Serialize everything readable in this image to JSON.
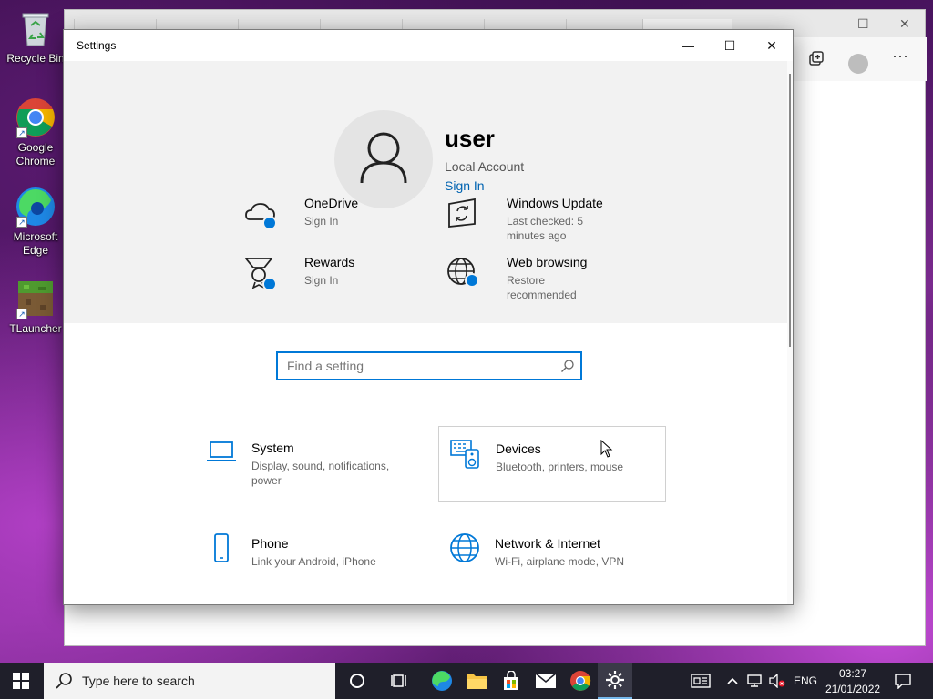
{
  "desktop": {
    "icons": [
      {
        "label": "Recycle Bin",
        "icon": "recycle-bin-icon"
      },
      {
        "label": "Google Chrome",
        "icon": "chrome-icon"
      },
      {
        "label": "Microsoft Edge",
        "icon": "edge-icon"
      },
      {
        "label": "TLauncher",
        "icon": "tlauncher-icon"
      }
    ]
  },
  "settings": {
    "window_title": "Settings",
    "controls": {
      "minimize": "—",
      "maximize": "☐",
      "close": "✕"
    },
    "account": {
      "name": "user",
      "type": "Local Account",
      "sign_in": "Sign In"
    },
    "quick_links": [
      {
        "title": "OneDrive",
        "subtitle": "Sign In",
        "icon": "onedrive-icon"
      },
      {
        "title": "Windows Update",
        "subtitle": "Last checked: 5 minutes ago",
        "icon": "windows-update-icon"
      },
      {
        "title": "Rewards",
        "subtitle": "Sign In",
        "icon": "rewards-icon"
      },
      {
        "title": "Web browsing",
        "subtitle": "Restore recommended",
        "icon": "web-browsing-icon"
      }
    ],
    "search": {
      "placeholder": "Find a setting"
    },
    "categories": [
      {
        "title": "System",
        "subtitle": "Display, sound, notifications, power",
        "icon": "laptop-icon"
      },
      {
        "title": "Devices",
        "subtitle": "Bluetooth, printers, mouse",
        "icon": "devices-icon"
      },
      {
        "title": "Phone",
        "subtitle": "Link your Android, iPhone",
        "icon": "phone-icon"
      },
      {
        "title": "Network & Internet",
        "subtitle": "Wi-Fi, airplane mode, VPN",
        "icon": "globe-icon"
      }
    ],
    "accent_color": "#0078d7"
  },
  "taskbar": {
    "search_placeholder": "Type here to search",
    "language": "ENG",
    "time": "03:27",
    "date": "21/01/2022"
  }
}
